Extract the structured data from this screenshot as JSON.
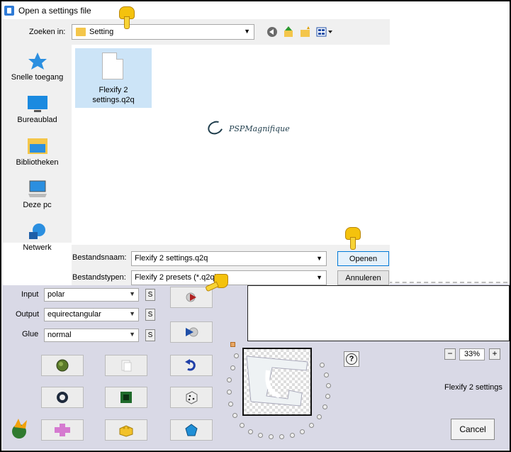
{
  "dialog": {
    "title": "Open a settings file",
    "lookin": {
      "label": "Zoeken in:",
      "value": "Setting"
    },
    "places": [
      {
        "label": "Snelle toegang",
        "icon": "star-icon"
      },
      {
        "label": "Bureaublad",
        "icon": "desktop-icon"
      },
      {
        "label": "Bibliotheken",
        "icon": "library-icon"
      },
      {
        "label": "Deze pc",
        "icon": "computer-icon"
      },
      {
        "label": "Netwerk",
        "icon": "network-icon"
      }
    ],
    "files": [
      {
        "name_line1": "Flexify 2",
        "name_line2": "settings.q2q",
        "selected": true
      }
    ],
    "watermark": "PSPMagnifique",
    "filename": {
      "label": "Bestandsnaam:",
      "value": "Flexify 2 settings.q2q"
    },
    "filetype": {
      "label": "Bestandstypen:",
      "value": "Flexify 2 presets (*.q2q)"
    },
    "open_label": "Openen",
    "cancel_label": "Annuleren"
  },
  "plugin": {
    "input": {
      "label": "Input",
      "value": "polar"
    },
    "output": {
      "label": "Output",
      "value": "equirectangular"
    },
    "glue": {
      "label": "Glue",
      "value": "normal"
    },
    "s_label": "S",
    "help_label": "?",
    "zoom": {
      "minus": "−",
      "value": "33%",
      "plus": "+"
    },
    "settings_name": "Flexify 2 settings",
    "cancel_label": "Cancel"
  },
  "colors": {
    "accent": "#0078d7",
    "selection": "#cce4f7",
    "panel": "#d9d9e6",
    "hand": "#f4c20d"
  }
}
